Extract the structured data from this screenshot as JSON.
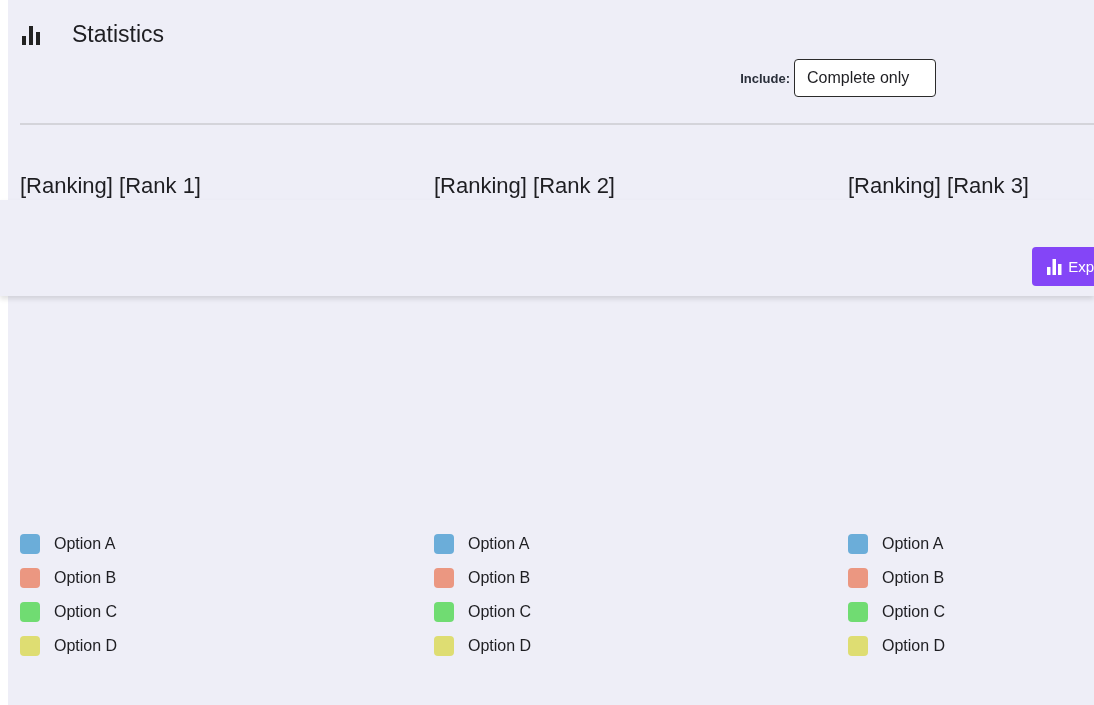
{
  "header": {
    "title": "Statistics"
  },
  "filter": {
    "label": "Include:",
    "value": "Complete only"
  },
  "panels": [
    {
      "title": "[Ranking] [Rank 1]",
      "legend": [
        {
          "label": "Option A",
          "color": "#6badd9"
        },
        {
          "label": "Option B",
          "color": "#eb9781"
        },
        {
          "label": "Option C",
          "color": "#70dc72"
        },
        {
          "label": "Option D",
          "color": "#dedd72"
        }
      ]
    },
    {
      "title": "[Ranking] [Rank 2]",
      "legend": [
        {
          "label": "Option A",
          "color": "#6badd9"
        },
        {
          "label": "Option B",
          "color": "#eb9781"
        },
        {
          "label": "Option C",
          "color": "#70dc72"
        },
        {
          "label": "Option D",
          "color": "#dedd72"
        }
      ]
    },
    {
      "title": "[Ranking] [Rank 3]",
      "legend": [
        {
          "label": "Option A",
          "color": "#6badd9"
        },
        {
          "label": "Option B",
          "color": "#eb9781"
        },
        {
          "label": "Option C",
          "color": "#70dc72"
        },
        {
          "label": "Option D",
          "color": "#dedd72"
        }
      ]
    }
  ],
  "floating_bar": {
    "button": "Exp"
  }
}
